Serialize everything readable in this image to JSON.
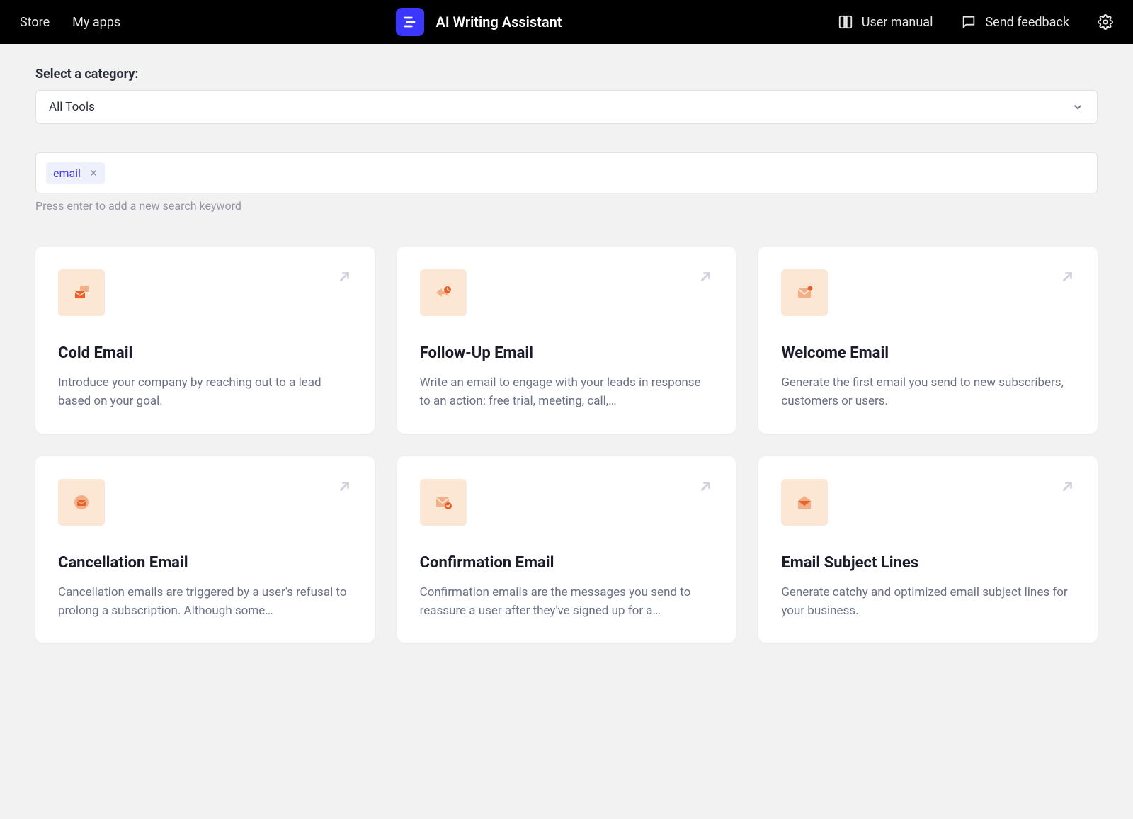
{
  "topbar": {
    "store_label": "Store",
    "my_apps_label": "My apps",
    "app_title": "AI Writing Assistant",
    "user_manual_label": "User manual",
    "send_feedback_label": "Send feedback"
  },
  "category": {
    "label": "Select a category:",
    "selected": "All Tools"
  },
  "search": {
    "chips": [
      {
        "text": "email"
      }
    ],
    "hint": "Press enter to add a new search keyword"
  },
  "cards": [
    {
      "icon": "mail-send-icon",
      "title": "Cold Email",
      "desc": "Introduce your company by reaching out to a lead based on your goal."
    },
    {
      "icon": "reply-clock-icon",
      "title": "Follow-Up Email",
      "desc": "Write an email to engage with your leads in response to an action: free trial, meeting, call,…"
    },
    {
      "icon": "mail-dot-icon",
      "title": "Welcome Email",
      "desc": "Generate the first email you send to new subscribers, customers or users."
    },
    {
      "icon": "mail-circle-icon",
      "title": "Cancellation Email",
      "desc": "Cancellation emails are triggered by a user's refusal to prolong a subscription. Although some…"
    },
    {
      "icon": "mail-check-icon",
      "title": "Confirmation Email",
      "desc": "Confirmation emails are the messages you send to reassure a user after they've signed up for a…"
    },
    {
      "icon": "mail-open-icon",
      "title": "Email Subject Lines",
      "desc": "Generate catchy and optimized email subject lines for your business."
    }
  ],
  "colors": {
    "accent": "#e8602a",
    "icon_bg": "#fce7d4",
    "chip_text": "#4a3fff"
  }
}
